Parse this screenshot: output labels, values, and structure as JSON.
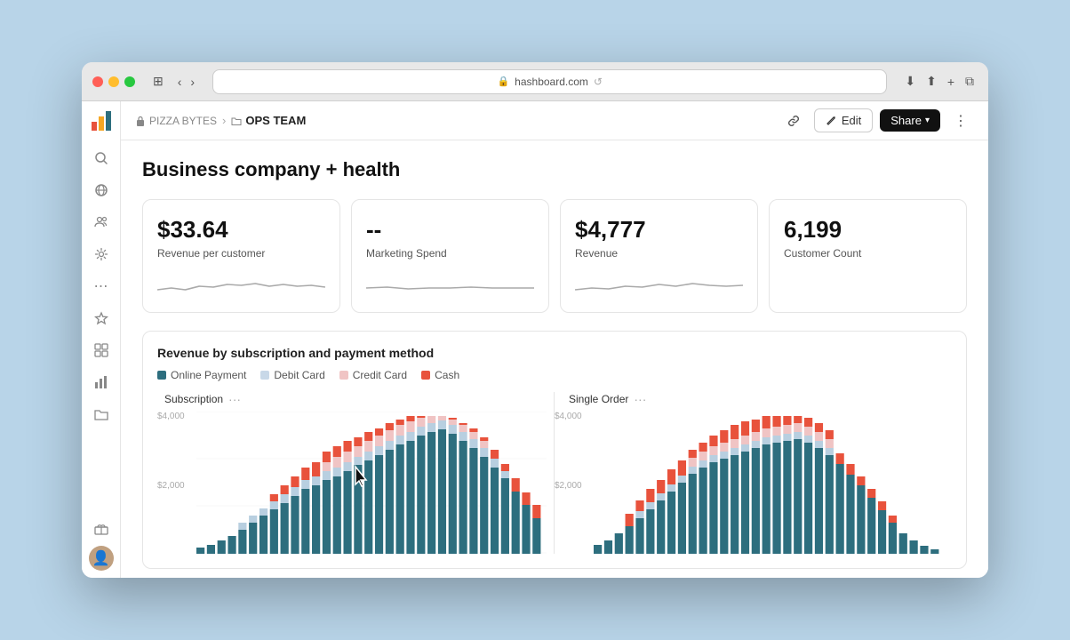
{
  "browser": {
    "url": "hashboard.com",
    "back_label": "‹",
    "forward_label": "›",
    "sidebar_toggle": "⊞"
  },
  "breadcrumb": {
    "root": "PIZZA BYTES",
    "separator": "›",
    "current": "OPS TEAM"
  },
  "toolbar": {
    "link_icon": "🔗",
    "edit_label": "Edit",
    "share_label": "Share",
    "more_icon": "⋮"
  },
  "sidebar": {
    "logo_icon": "📊",
    "icons": [
      "🔍",
      "🌐",
      "👥",
      "⚙️",
      "⋯",
      "☆",
      "☰",
      "⚙️",
      "📁"
    ]
  },
  "dashboard": {
    "title": "Business company + health",
    "kpis": [
      {
        "value": "$33.64",
        "label": "Revenue per customer",
        "has_sparkline": true
      },
      {
        "value": "--",
        "label": "Marketing Spend",
        "has_sparkline": true
      },
      {
        "value": "$4,777",
        "label": "Revenue",
        "has_sparkline": true
      },
      {
        "value": "6,199",
        "label": "Customer Count",
        "has_sparkline": false
      }
    ],
    "chart": {
      "title": "Revenue by subscription and payment method",
      "legend": [
        {
          "label": "Online Payment",
          "color": "#2d6e7e"
        },
        {
          "label": "Debit Card",
          "color": "#c8d8e8"
        },
        {
          "label": "Credit Card",
          "color": "#f0c4c4"
        },
        {
          "label": "Cash",
          "color": "#e8523c"
        }
      ],
      "panes": [
        {
          "title": "Subscription",
          "y_labels": [
            "$4,000",
            "$2,000",
            ""
          ]
        },
        {
          "title": "Single Order",
          "y_labels": [
            "$4,000",
            "$2,000",
            ""
          ]
        }
      ]
    }
  }
}
